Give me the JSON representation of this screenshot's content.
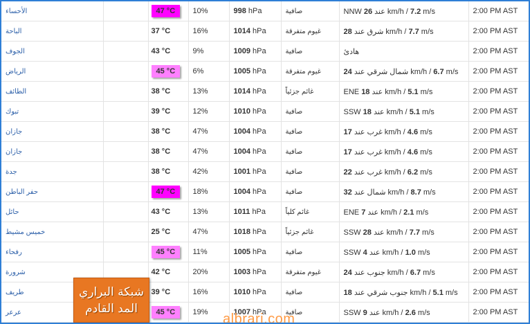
{
  "rows": [
    {
      "city": "الأحساء",
      "temp": "47 °C",
      "temp_level": "hot47",
      "humidity": "10%",
      "pressure_value": "998",
      "pressure_unit": "hPa",
      "condition": "صافية",
      "wind_dir": "NNW",
      "wind_kmh": "26",
      "wind_mid": "عند km/h /",
      "wind_ms": "7.2",
      "wind_unit": "m/s",
      "time": "2:00 PM AST"
    },
    {
      "city": "الباحة",
      "temp": "37 °C",
      "temp_level": "normal",
      "humidity": "16%",
      "pressure_value": "1014",
      "pressure_unit": "hPa",
      "condition": "غيوم متفرقة",
      "wind_dir": "",
      "wind_kmh": "28",
      "wind_mid": "شرق عند km/h /",
      "wind_ms": "7.7",
      "wind_unit": "m/s",
      "time": "2:00 PM AST"
    },
    {
      "city": "الجوف",
      "temp": "43 °C",
      "temp_level": "normal",
      "humidity": "9%",
      "pressure_value": "1009",
      "pressure_unit": "hPa",
      "condition": "صافية",
      "wind_dir": "",
      "wind_kmh": "",
      "wind_mid": "هادئ",
      "wind_ms": "",
      "wind_unit": "",
      "time": "2:00 PM AST"
    },
    {
      "city": "الرياض",
      "temp": "45 °C",
      "temp_level": "hot45",
      "humidity": "6%",
      "pressure_value": "1005",
      "pressure_unit": "hPa",
      "condition": "غيوم متفرقة",
      "wind_dir": "",
      "wind_kmh": "24",
      "wind_mid": "شمال شرقي عند km/h /",
      "wind_ms": "6.7",
      "wind_unit": "m/s",
      "time": "2:00 PM AST"
    },
    {
      "city": "الطائف",
      "temp": "38 °C",
      "temp_level": "normal",
      "humidity": "13%",
      "pressure_value": "1014",
      "pressure_unit": "hPa",
      "condition": "غائم جزئياً",
      "wind_dir": "ENE",
      "wind_kmh": "18",
      "wind_mid": "عند km/h /",
      "wind_ms": "5.1",
      "wind_unit": "m/s",
      "time": "2:00 PM AST"
    },
    {
      "city": "تبوك",
      "temp": "39 °C",
      "temp_level": "normal",
      "humidity": "12%",
      "pressure_value": "1010",
      "pressure_unit": "hPa",
      "condition": "صافية",
      "wind_dir": "SSW",
      "wind_kmh": "18",
      "wind_mid": "عند km/h /",
      "wind_ms": "5.1",
      "wind_unit": "m/s",
      "time": "2:00 PM AST"
    },
    {
      "city": "جازان",
      "temp": "38 °C",
      "temp_level": "normal",
      "humidity": "47%",
      "pressure_value": "1004",
      "pressure_unit": "hPa",
      "condition": "صافية",
      "wind_dir": "",
      "wind_kmh": "17",
      "wind_mid": "غرب عند km/h /",
      "wind_ms": "4.6",
      "wind_unit": "m/s",
      "time": "2:00 PM AST"
    },
    {
      "city": "جازان",
      "temp": "38 °C",
      "temp_level": "normal",
      "humidity": "47%",
      "pressure_value": "1004",
      "pressure_unit": "hPa",
      "condition": "صافية",
      "wind_dir": "",
      "wind_kmh": "17",
      "wind_mid": "غرب عند km/h /",
      "wind_ms": "4.6",
      "wind_unit": "m/s",
      "time": "2:00 PM AST"
    },
    {
      "city": "جدة",
      "temp": "38 °C",
      "temp_level": "normal",
      "humidity": "42%",
      "pressure_value": "1001",
      "pressure_unit": "hPa",
      "condition": "صافية",
      "wind_dir": "",
      "wind_kmh": "22",
      "wind_mid": "غرب عند km/h /",
      "wind_ms": "6.2",
      "wind_unit": "m/s",
      "time": "2:00 PM AST"
    },
    {
      "city": "حفر الباطن",
      "temp": "47 °C",
      "temp_level": "hot47",
      "humidity": "18%",
      "pressure_value": "1004",
      "pressure_unit": "hPa",
      "condition": "صافية",
      "wind_dir": "",
      "wind_kmh": "32",
      "wind_mid": "شمال عند km/h /",
      "wind_ms": "8.7",
      "wind_unit": "m/s",
      "time": "2:00 PM AST"
    },
    {
      "city": "حائل",
      "temp": "43 °C",
      "temp_level": "normal",
      "humidity": "13%",
      "pressure_value": "1011",
      "pressure_unit": "hPa",
      "condition": "غائم كلياً",
      "wind_dir": "ENE",
      "wind_kmh": "7",
      "wind_mid": "عند km/h /",
      "wind_ms": "2.1",
      "wind_unit": "m/s",
      "time": "2:00 PM AST"
    },
    {
      "city": "خميس مشيط",
      "temp": "25 °C",
      "temp_level": "normal",
      "humidity": "47%",
      "pressure_value": "1018",
      "pressure_unit": "hPa",
      "condition": "غائم جزئياً",
      "wind_dir": "SSW",
      "wind_kmh": "28",
      "wind_mid": "عند km/h /",
      "wind_ms": "7.7",
      "wind_unit": "m/s",
      "time": "2:00 PM AST"
    },
    {
      "city": "رفحاء",
      "temp": "45 °C",
      "temp_level": "hot45",
      "humidity": "11%",
      "pressure_value": "1005",
      "pressure_unit": "hPa",
      "condition": "صافية",
      "wind_dir": "SSW",
      "wind_kmh": "4",
      "wind_mid": "عند km/h /",
      "wind_ms": "1.0",
      "wind_unit": "m/s",
      "time": "2:00 PM AST"
    },
    {
      "city": "شرورة",
      "temp": "42 °C",
      "temp_level": "normal",
      "humidity": "20%",
      "pressure_value": "1003",
      "pressure_unit": "hPa",
      "condition": "غيوم متفرقة",
      "wind_dir": "",
      "wind_kmh": "24",
      "wind_mid": "جنوب عند km/h /",
      "wind_ms": "6.7",
      "wind_unit": "m/s",
      "time": "2:00 PM AST"
    },
    {
      "city": "طريف",
      "temp": "39 °C",
      "temp_level": "normal",
      "humidity": "16%",
      "pressure_value": "1010",
      "pressure_unit": "hPa",
      "condition": "صافية",
      "wind_dir": "",
      "wind_kmh": "18",
      "wind_mid": "جنوب شرقي عند km/h /",
      "wind_ms": "5.1",
      "wind_unit": "m/s",
      "time": "2:00 PM AST"
    },
    {
      "city": "عرعر",
      "temp": "45 °C",
      "temp_level": "hot45",
      "humidity": "19%",
      "pressure_value": "1007",
      "pressure_unit": "hPa",
      "condition": "صافية",
      "wind_dir": "SSW",
      "wind_kmh": "9",
      "wind_mid": "عند km/h /",
      "wind_ms": "2.6",
      "wind_unit": "m/s",
      "time": "2:00 PM AST"
    }
  ],
  "logo": {
    "line1": "شبكة البراري",
    "line2": "المد القادم"
  },
  "watermark": "albrari.com",
  "colors": {
    "frame": "#2f7fd6",
    "hot47": "#ff00ff",
    "hot45": "#ff80ff",
    "logo_bg": "#e87722",
    "city_text": "#2a5ea8"
  }
}
